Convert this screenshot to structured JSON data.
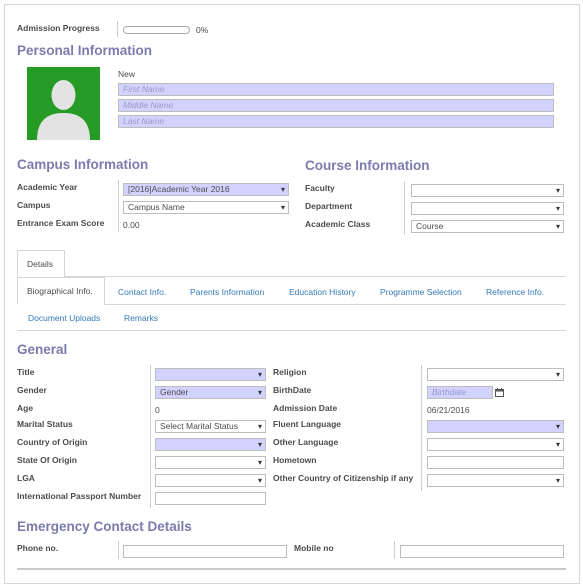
{
  "progress": {
    "label": "Admission Progress",
    "percent": 0,
    "percent_text": "0%"
  },
  "personal": {
    "heading": "Personal Information",
    "status": "New",
    "first_name_placeholder": "First Name",
    "middle_name_placeholder": "Middle Name",
    "last_name_placeholder": "Last Name"
  },
  "campus": {
    "heading": "Campus Information",
    "academic_year_label": "Academic Year",
    "academic_year_value": "[2016]Academic Year 2016",
    "campus_label": "Campus",
    "campus_value": "Campus Name",
    "exam_score_label": "Entrance Exam Score",
    "exam_score_value": "0.00"
  },
  "course": {
    "heading": "Course Information",
    "faculty_label": "Faculty",
    "department_label": "Department",
    "academic_class_label": "Academic Class",
    "academic_class_value": "Course"
  },
  "tabs": {
    "outer": "Details",
    "inner": [
      "Biographical Info.",
      "Contact Info.",
      "Parents Information",
      "Education History",
      "Programme Selection",
      "Reference Info.",
      "Document Uploads",
      "Remarks"
    ]
  },
  "general": {
    "heading": "General",
    "title_label": "Title",
    "gender_label": "Gender",
    "gender_value": "Gender",
    "age_label": "Age",
    "age_value": "0",
    "marital_label": "Marital Status",
    "marital_value": "Select Marital Status",
    "country_label": "Country of Origin",
    "state_label": "State Of Origin",
    "lga_label": "LGA",
    "passport_label": "International Passport Number",
    "religion_label": "Religion",
    "birthdate_label": "BirthDate",
    "birthdate_placeholder": "Birthdate",
    "admission_date_label": "Admission Date",
    "admission_date_value": "06/21/2016",
    "fluent_label": "Fluent Language",
    "other_lang_label": "Other Language",
    "hometown_label": "Hometown",
    "other_country_label": "Other Country of Citizenship if any"
  },
  "emergency": {
    "heading": "Emergency Contact Details",
    "phone_label": "Phone no.",
    "mobile_label": "Mobile no"
  },
  "icons": {
    "avatar": "person-silhouette-icon",
    "calendar": "calendar-icon",
    "dropdown": "caret-down-icon"
  },
  "colors": {
    "heading": "#7c7bad",
    "required_field": "#d2d2ff",
    "avatar_bg": "#269c26",
    "link": "#337ab7"
  }
}
